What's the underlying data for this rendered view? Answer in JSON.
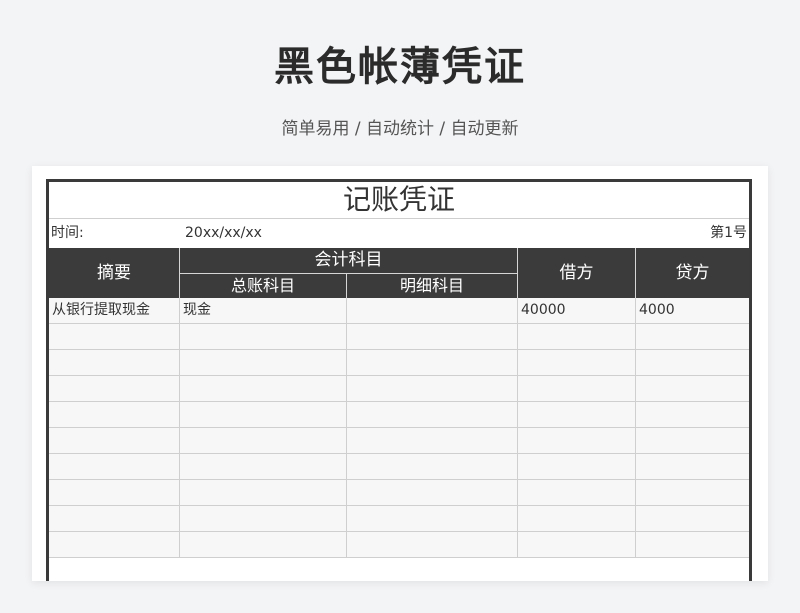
{
  "header": {
    "title": "黑色帐薄凭证",
    "subtitle": "简单易用 / 自动统计 / 自动更新"
  },
  "voucher": {
    "title": "记账凭证",
    "time_label": "时间:",
    "date": "20xx/xx/xx",
    "number": "第1号",
    "columns": {
      "summary": "摘要",
      "account_group": "会计科目",
      "general_ledger": "总账科目",
      "detail_account": "明细科目",
      "debit": "借方",
      "credit": "贷方"
    },
    "rows": [
      {
        "summary": "从银行提取现金",
        "general_ledger": "现金",
        "detail_account": "",
        "debit": "40000",
        "credit": "4000"
      },
      {
        "summary": "",
        "general_ledger": "",
        "detail_account": "",
        "debit": "",
        "credit": ""
      },
      {
        "summary": "",
        "general_ledger": "",
        "detail_account": "",
        "debit": "",
        "credit": ""
      },
      {
        "summary": "",
        "general_ledger": "",
        "detail_account": "",
        "debit": "",
        "credit": ""
      },
      {
        "summary": "",
        "general_ledger": "",
        "detail_account": "",
        "debit": "",
        "credit": ""
      },
      {
        "summary": "",
        "general_ledger": "",
        "detail_account": "",
        "debit": "",
        "credit": ""
      },
      {
        "summary": "",
        "general_ledger": "",
        "detail_account": "",
        "debit": "",
        "credit": ""
      },
      {
        "summary": "",
        "general_ledger": "",
        "detail_account": "",
        "debit": "",
        "credit": ""
      },
      {
        "summary": "",
        "general_ledger": "",
        "detail_account": "",
        "debit": "",
        "credit": ""
      },
      {
        "summary": "",
        "general_ledger": "",
        "detail_account": "",
        "debit": "",
        "credit": ""
      }
    ]
  },
  "colors": {
    "header_bg": "#3b3b3b",
    "page_bg": "#f3f4f6",
    "cell_bg": "#f7f7f7"
  }
}
